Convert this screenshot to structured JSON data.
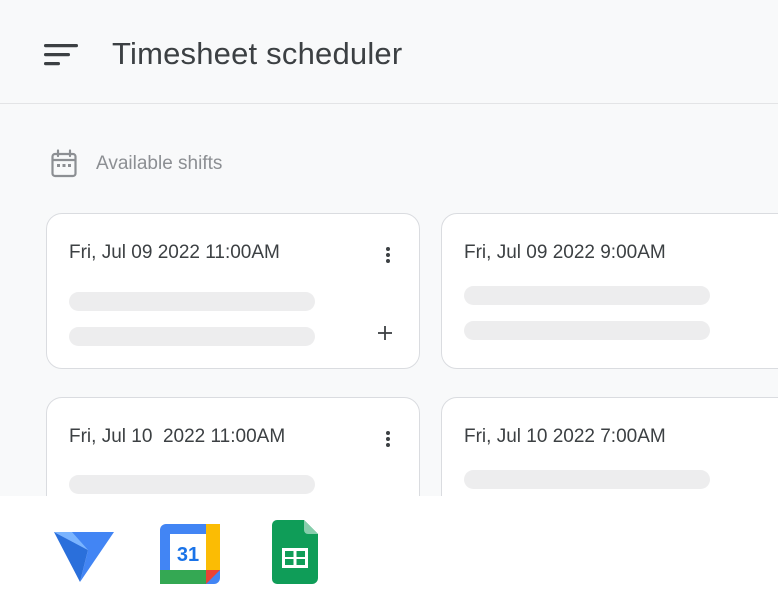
{
  "header": {
    "title": "Timesheet scheduler",
    "menu_icon": "sort-menu-icon"
  },
  "section": {
    "label": "Available shifts",
    "icon": "calendar-icon"
  },
  "shifts": [
    {
      "datetime": "Fri, Jul 09 2022 11:00AM",
      "has_more_menu": true,
      "has_add": true
    },
    {
      "datetime": "Fri, Jul 09 2022 9:00AM",
      "has_more_menu": false,
      "has_add": false
    },
    {
      "datetime": "Fri, Jul 10  2022 11:00AM",
      "has_more_menu": true,
      "has_add": false
    },
    {
      "datetime": "Fri, Jul 10 2022 7:00AM",
      "has_more_menu": false,
      "has_add": false
    }
  ],
  "integrations": {
    "appsheet": {
      "icon": "appsheet-logo-icon"
    },
    "calendar": {
      "icon": "google-calendar-logo-icon",
      "day": "31"
    },
    "sheets": {
      "icon": "google-sheets-logo-icon"
    }
  },
  "colors": {
    "background": "#f8f9fa",
    "card_border": "#dadce0",
    "title_text": "#3c4043",
    "muted_text": "#8c8f93",
    "skeleton": "#ededee",
    "google_blue": "#4285f4",
    "google_green": "#34a853",
    "google_yellow": "#fbbc04",
    "google_red": "#ea4335"
  }
}
